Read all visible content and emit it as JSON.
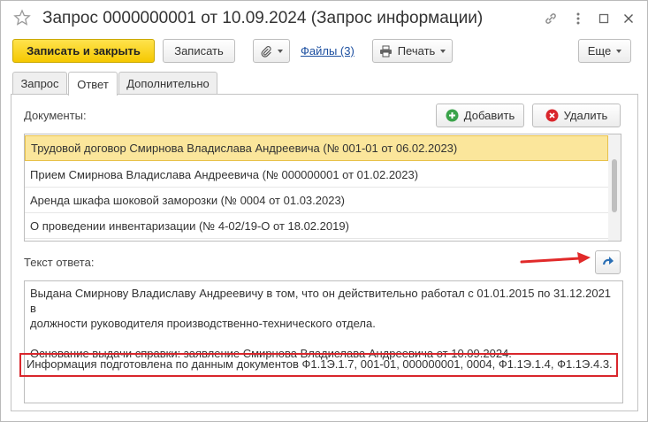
{
  "window": {
    "title": "Запрос 0000000001 от 10.09.2024 (Запрос информации)"
  },
  "toolbar": {
    "save_close": "Записать и закрыть",
    "save": "Записать",
    "files": "Файлы (3)",
    "print": "Печать",
    "more": "Еще"
  },
  "tabs": [
    {
      "label": "Запрос"
    },
    {
      "label": "Ответ"
    },
    {
      "label": "Дополнительно"
    }
  ],
  "documents": {
    "label": "Документы:",
    "add": "Добавить",
    "remove": "Удалить",
    "items": [
      {
        "text": "Трудовой договор Смирнова Владислава Андреевича (№ 001-01 от 06.02.2023)"
      },
      {
        "text": "Прием Смирнова Владислава Андреевича (№ 000000001 от 01.02.2023)"
      },
      {
        "text": "Аренда шкафа шоковой заморозки (№ 0004 от 01.03.2023)"
      },
      {
        "text": "О проведении инвентаризации (№ 4-02/19-О от 18.02.2019)"
      }
    ]
  },
  "answer": {
    "label": "Текст ответа:",
    "line1": "Выдана Смирнову Владиславу Андреевичу в том, что он действительно работал с 01.01.2015 по 31.12.2021 в",
    "line2": "должности руководителя производственно-технического отдела.",
    "line3": "Основание выдачи справки: заявление Смирнова Владислава Андреевича от 10.09.2024.",
    "line4": "Информация подготовлена по данным документов Ф1.1Э.1.7, 001-01, 000000001, 0004, Ф1.1Э.1.4, Ф1.1Э.4.3."
  },
  "colors": {
    "accent_yellow": "#f5c800",
    "highlight_red": "#d9262c",
    "selected_row": "#fbe69b",
    "link_blue": "#1c4fa0"
  }
}
